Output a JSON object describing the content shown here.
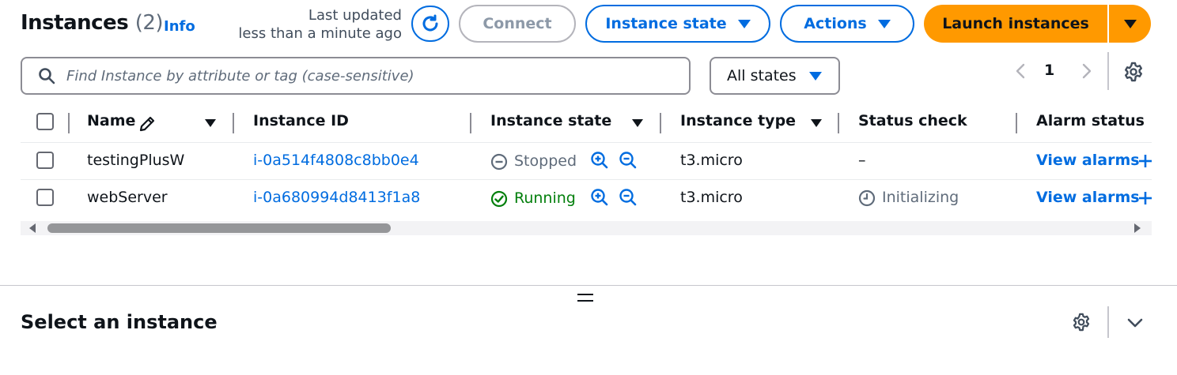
{
  "header": {
    "title": "Instances",
    "count": "(2)",
    "info": "Info",
    "last_updated_line1": "Last updated",
    "last_updated_line2": "less than a minute ago",
    "connect_label": "Connect",
    "instance_state_label": "Instance state",
    "actions_label": "Actions",
    "launch_label": "Launch instances"
  },
  "search": {
    "placeholder": "Find Instance by attribute or tag (case-sensitive)",
    "value": ""
  },
  "filter": {
    "selected": "All states"
  },
  "pagination": {
    "current_page": "1"
  },
  "table": {
    "columns": [
      "Name",
      "Instance ID",
      "Instance state",
      "Instance type",
      "Status check",
      "Alarm status"
    ],
    "rows": [
      {
        "name": "testingPlusW",
        "instance_id": "i-0a514f4808c8bb0e4",
        "state": "Stopped",
        "type": "t3.micro",
        "status_check": "–",
        "alarm": "View alarms"
      },
      {
        "name": "webServer",
        "instance_id": "i-0a680994d8413f1a8",
        "state": "Running",
        "type": "t3.micro",
        "status_check": "Initializing",
        "alarm": "View alarms"
      }
    ]
  },
  "panel": {
    "title": "Select an instance"
  },
  "icons": {
    "refresh": "refresh-icon",
    "search": "search-icon",
    "settings": "gear-icon",
    "edit": "pencil-icon",
    "zoom_in": "zoom-in-icon",
    "zoom_out": "zoom-out-icon",
    "stopped": "stopped-status-icon",
    "running": "running-status-icon",
    "pending": "clock-icon",
    "add": "plus-icon"
  },
  "colors": {
    "accent": "#006ce0",
    "primary_button": "#ff9900",
    "success": "#037f0c",
    "muted": "#5f6b7a"
  }
}
